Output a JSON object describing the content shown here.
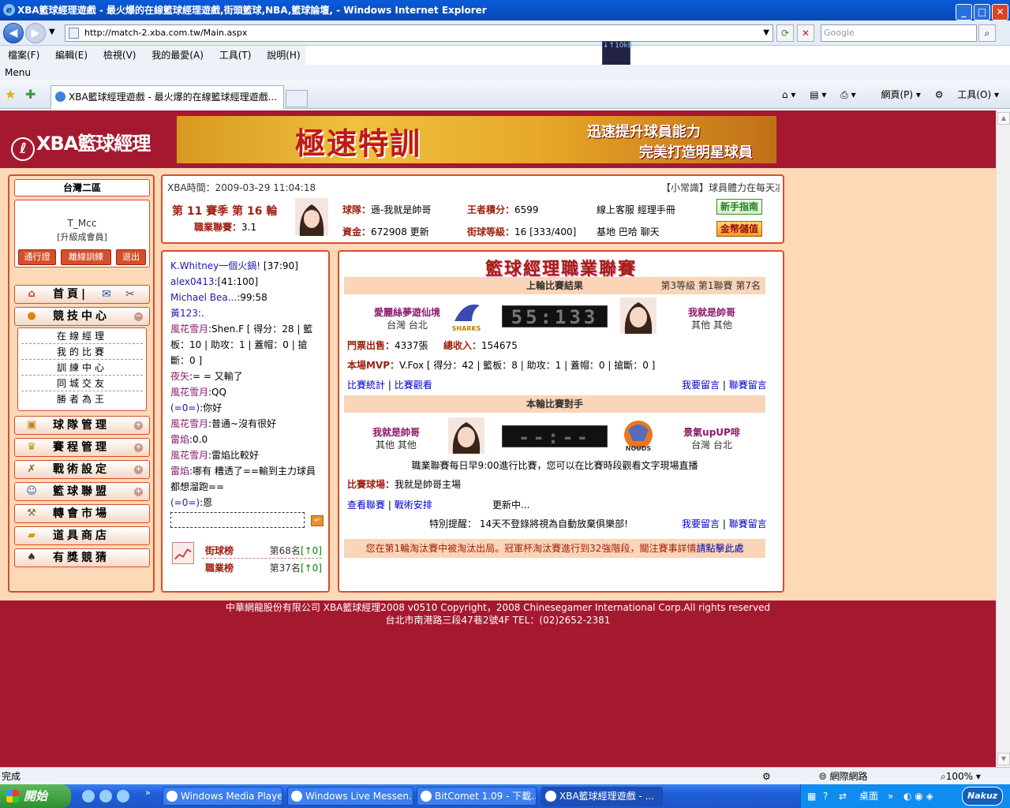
{
  "window": {
    "title": "XBA籃球經理遊戲 - 最火爆的在線籃球經理遊戲,街頭籃球,NBA,籃球論壇, - Windows Internet Explorer"
  },
  "browser": {
    "url": "http://match-2.xba.com.tw/Main.aspx",
    "search_placeholder": "Google",
    "menu": [
      "檔案(F)",
      "編輯(E)",
      "檢視(V)",
      "我的最愛(A)",
      "工具(T)",
      "說明(H)"
    ],
    "menu2": "Menu",
    "netmon": "↓↑10kB",
    "tab_title": "XBA籃球經理遊戲 - 最火爆的在線籃球經理遊戲...",
    "toolbar_page": "網頁(P)",
    "toolbar_tools": "工具(O)",
    "status_text": "完成",
    "status_zone": "網際網路",
    "status_zoom": "100%"
  },
  "header": {
    "logo_text": "XBA籃球經理",
    "banner_main": "極速特訓",
    "banner_line1": "迅速提升球員能力",
    "banner_line2": "完美打造明星球員"
  },
  "sidebar": {
    "region": "台灣二區",
    "username": "T_Mcc",
    "userlevel": "[升級成會員]",
    "buttons": [
      "通行證",
      "離線訓練",
      "退出"
    ],
    "home": "首頁|",
    "competition": "競技中心",
    "submenu": [
      "在線經理",
      "我的比賽",
      "訓練中心",
      "同城交友",
      "勝者為王"
    ],
    "items": [
      "球隊管理",
      "賽程管理",
      "戰術設定",
      "籃球聯盟",
      "轉會市場",
      "道具商店",
      "有獎競猜"
    ]
  },
  "info": {
    "xba_time": "XBA時間：2009-03-29 11:04:18",
    "tip": "【小常識】球員體力在每天凌",
    "season": "第 11 賽季 第 16 輪",
    "league_label": "職業聯賽：",
    "league_value": "3.1",
    "team_label": "球隊：",
    "team_value": "遜-我就是帥哥",
    "score_label": "王者積分：",
    "score_value": "6599",
    "links1": "線上客服  經理手冊",
    "funds_label": "資金：",
    "funds_value": "672908",
    "update": "更新",
    "level_label": "街球等級：",
    "level_value": "16 [333/400]",
    "links2": "基地  巴哈  聊天",
    "guide_btn": "新手指南",
    "gold_btn": "金幣儲值"
  },
  "chat": {
    "lines": [
      {
        "name": "K.Whitney一個火鍋!",
        "text": "  [37:90]",
        "cls": "nb"
      },
      {
        "name": "alex0413",
        "text": ":[41:100]",
        "cls": "nb"
      },
      {
        "name": "Michael Bea...",
        "text": ":99:58",
        "cls": "nb"
      },
      {
        "name": "黃123",
        "text": ":.",
        "cls": "nb"
      },
      {
        "name": "風花雪月",
        "text": ":Shen.F [ 得分：28 | 籃板：10 | 助攻：1 | 蓋帽：0 | 搶斷：0 ]",
        "cls": "n"
      },
      {
        "name": "夜矢",
        "text": ":= = 又輸了",
        "cls": "n"
      },
      {
        "name": "風花雪月",
        "text": ":QQ",
        "cls": "n"
      },
      {
        "name": "(=0=)",
        "text": ":你好",
        "cls": "nb"
      },
      {
        "name": "風花雪月",
        "text": ":普通~沒有很好",
        "cls": "n"
      },
      {
        "name": "雷焰",
        "text": ":0.0",
        "cls": "n"
      },
      {
        "name": "風花雪月",
        "text": ":雷焰比較好",
        "cls": "n"
      },
      {
        "name": "雷焰",
        "text": ":哪有  糟透了==輸到主力球員都想溜跑==",
        "cls": "n"
      },
      {
        "name": "(=0=)",
        "text": ":恩",
        "cls": "nb"
      }
    ],
    "rank1_label": "街球榜",
    "rank1_value": "第68名",
    "rank1_change": "[↑0]",
    "rank2_label": "職業榜",
    "rank2_value": "第37名",
    "rank2_change": "[↑0]"
  },
  "game": {
    "title": "籃球經理職業聯賽",
    "last_head": "上輪比賽結果",
    "last_rank": "第3等級  第1聯賽  第7名",
    "home_team": "愛麗絲夢遊仙境",
    "home_loc": "台灣  台北",
    "home_logo_text": "SHARKS",
    "last_score": "55:133",
    "away_team": "我就是帥哥",
    "away_loc": "其他  其他",
    "tickets_label": "門票出售：",
    "tickets_value": "4337張",
    "income_label": "總收入：",
    "income_value": "154675",
    "mvp_label": "本場MVP：",
    "mvp_value": "V.Fox [ 得分：42 | 籃板：8 | 助攻：1 | 蓋帽：0 | 搶斷：0 ]",
    "stats_link": "比賽統計",
    "watch_link": "比賽觀看",
    "msg_link": "我要留言",
    "league_msg_link": "聯賽留言",
    "next_head": "本輪比賽對手",
    "next_home": "我就是帥哥",
    "next_home_loc": "其他  其他",
    "next_score": "--:--",
    "next_away": "景氣upUP啡",
    "next_away_loc": "台灣  台北",
    "next_logo_text": "NOUDS",
    "schedule_note": "職業聯賽每日早9:00進行比賽，您可以在比賽時段觀看文字現場直播",
    "venue_label": "比賽球場：",
    "venue_value": "我就是帥哥主場",
    "view_league": "查看聯賽",
    "tactics": "戰術安排",
    "updating": "更新中...",
    "reminder": "特別提醒： 14天不登錄將視為自動放棄俱樂部!",
    "msg_link2": "我要留言",
    "league_msg_link2": "聯賽留言",
    "notice_text": "您在第1輪淘汰賽中被淘汰出局。冠軍杯淘汰賽進行到32強階段，關注賽事詳情",
    "notice_link": "請點擊此處"
  },
  "footer": {
    "line1": "中華網龍股份有限公司  XBA籃球經理2008 v0510    Copyright，2008 Chinesegamer International Corp.All rights reserved",
    "line2": "台北市南港路三段47巷2號4F TEL：(02)2652-2381"
  },
  "taskbar": {
    "start": "開始",
    "items": [
      "Windows Media Player",
      "Windows Live Messen...",
      "BitComet 1.09 - 下載...",
      "XBA籃球經理遊戲 - ..."
    ],
    "tray_text": "桌面",
    "tray_brand": "Nakuz"
  }
}
